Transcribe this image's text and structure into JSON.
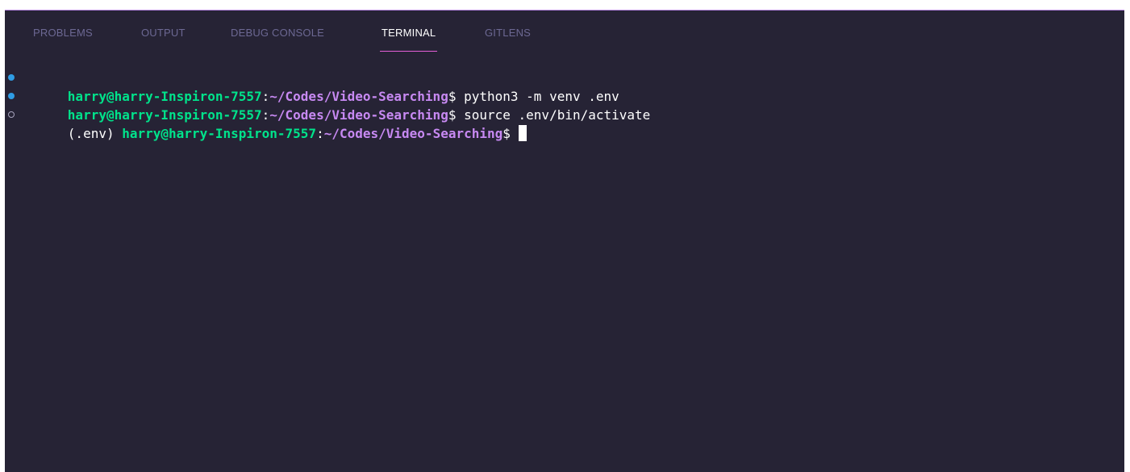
{
  "tabs": [
    {
      "label": "PROBLEMS",
      "active": false
    },
    {
      "label": "OUTPUT",
      "active": false
    },
    {
      "label": "DEBUG CONSOLE",
      "active": false
    },
    {
      "label": "TERMINAL",
      "active": true
    },
    {
      "label": "GITLENS",
      "active": false
    }
  ],
  "terminal": {
    "lines": [
      {
        "decoration": "success-dot",
        "env": "",
        "user_host": "harry@harry-Inspiron-7557",
        "colon": ":",
        "path": "~/Codes/Video-Searching",
        "prompt": "$",
        "command": " python3 -m venv .env"
      },
      {
        "decoration": "success-dot",
        "env": "",
        "user_host": "harry@harry-Inspiron-7557",
        "colon": ":",
        "path": "~/Codes/Video-Searching",
        "prompt": "$",
        "command": " source .env/bin/activate"
      },
      {
        "decoration": "pending-circle",
        "env": "(.env) ",
        "user_host": "harry@harry-Inspiron-7557",
        "colon": ":",
        "path": "~/Codes/Video-Searching",
        "prompt": "$",
        "command": " "
      }
    ]
  },
  "colors": {
    "panel_background": "#262335",
    "user_host": "#00e38b",
    "path": "#c789f2",
    "tab_inactive": "#6c6893",
    "tab_active": "#ffffff",
    "tab_underline": "#e45fd8",
    "success_dot": "#2f9de5"
  }
}
